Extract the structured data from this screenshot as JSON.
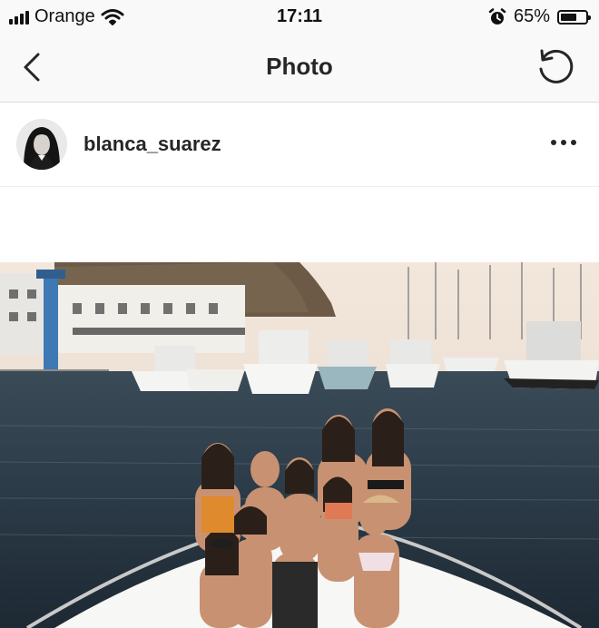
{
  "status_bar": {
    "carrier": "Orange",
    "time": "17:11",
    "battery_percent": "65%",
    "battery_level": 0.65
  },
  "nav": {
    "title": "Photo"
  },
  "post": {
    "username": "blanca_suarez"
  },
  "icons": [
    "signal-icon",
    "wifi-icon",
    "alarm-icon",
    "battery-icon",
    "back-chevron-icon",
    "refresh-icon",
    "more-options-icon"
  ],
  "colors": {
    "bar_background": "#f9f9f9",
    "text": "#262626",
    "divider": "#dbdbdb"
  }
}
